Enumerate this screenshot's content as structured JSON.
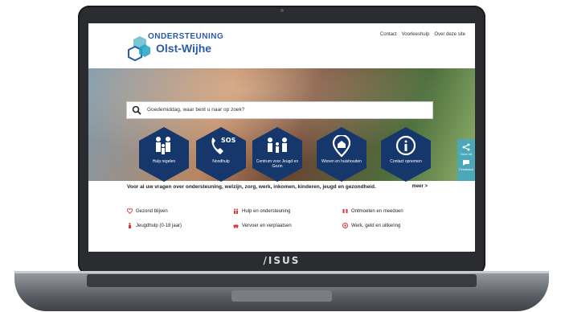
{
  "laptop": {
    "brand": "/ISUS"
  },
  "site": {
    "logo": {
      "line1": "ONDERSTEUNING",
      "line2": "Olst-Wijhe"
    },
    "nav": [
      "Contact",
      "Voorleeshulp",
      "Over deze site"
    ],
    "search": {
      "placeholder": "Goedemiddag, waar bent u naar op zoek?"
    },
    "tiles": [
      {
        "label": "Hulp regelen",
        "icon": "family-icon"
      },
      {
        "label": "Noodhulp",
        "icon": "phone-sos-icon",
        "badge": "SOS"
      },
      {
        "label": "Centrum voor Jeugd en Gezin",
        "icon": "family-icon"
      },
      {
        "label": "Wonen en huishouden",
        "icon": "home-pin-icon"
      },
      {
        "label": "Contact opnemen",
        "icon": "info-icon"
      }
    ],
    "side_share": {
      "share": "Deel dit",
      "feedback": "Feedback"
    },
    "intro": {
      "text": "Voor al uw vragen over ondersteuning, welzijn, zorg, werk, inkomen, kinderen, jeugd en gezondheid.",
      "more": "meer >"
    },
    "categories": [
      {
        "label": "Gezond blijven",
        "color": "#d33"
      },
      {
        "label": "Hulp en ondersteuning",
        "color": "#d33"
      },
      {
        "label": "Ontmoeten en meedoen",
        "color": "#d33"
      },
      {
        "label": "Jeugdhulp (0-18 jaar)",
        "color": "#d33"
      },
      {
        "label": "Vervoer en verplaatsen",
        "color": "#d33"
      },
      {
        "label": "Werk, geld en uitkering",
        "color": "#d33"
      }
    ]
  }
}
